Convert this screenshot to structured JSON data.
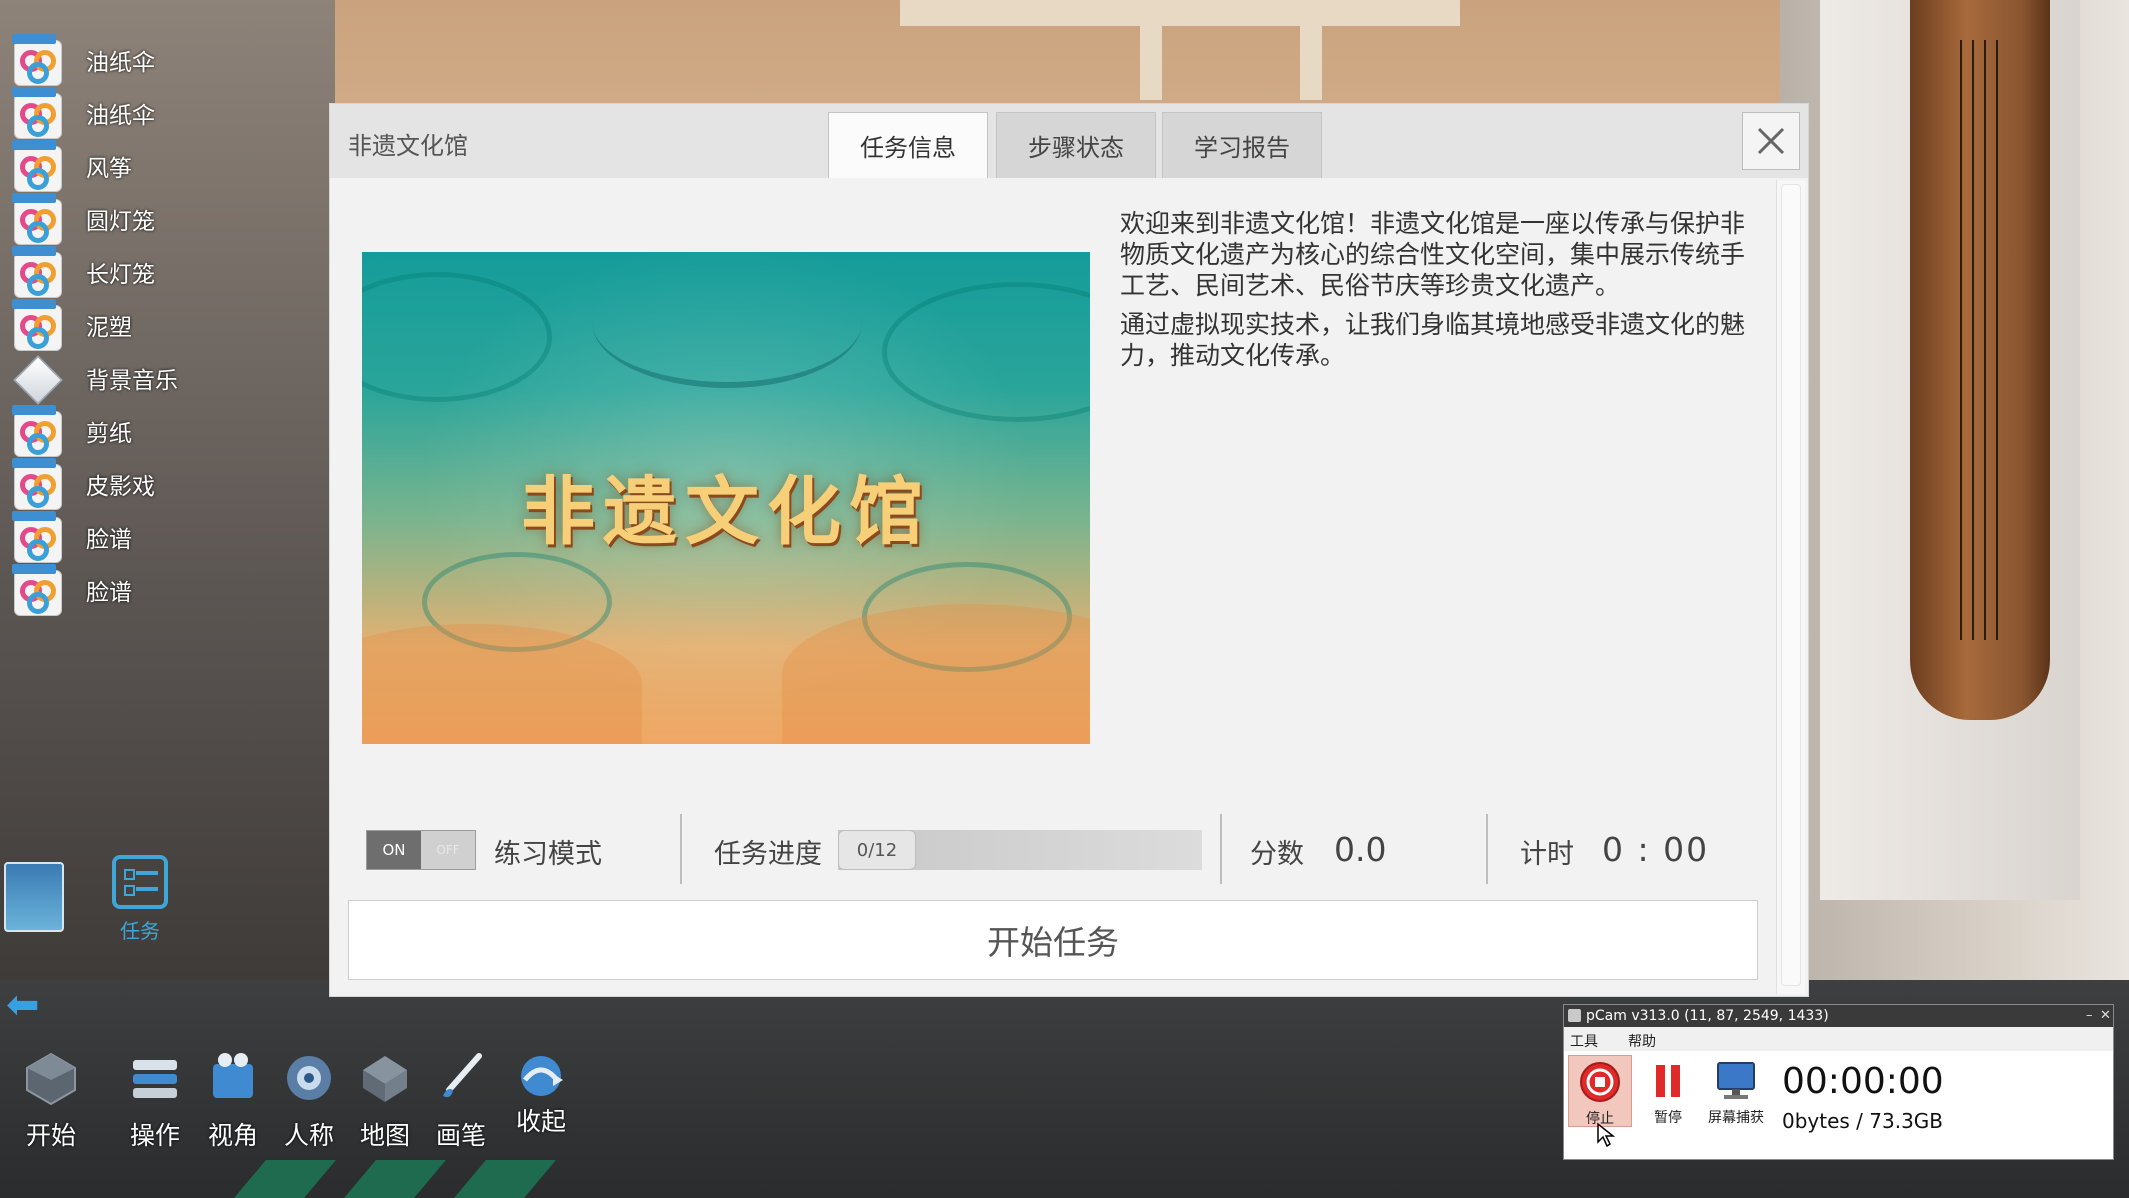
{
  "left_list": {
    "items": [
      {
        "label": "油纸伞"
      },
      {
        "label": "油纸伞"
      },
      {
        "label": "风筝"
      },
      {
        "label": "圆灯笼"
      },
      {
        "label": "长灯笼"
      },
      {
        "label": "泥塑"
      },
      {
        "label": "背景音乐"
      },
      {
        "label": "剪纸"
      },
      {
        "label": "皮影戏"
      },
      {
        "label": "脸谱"
      },
      {
        "label": "脸谱"
      }
    ],
    "task_label": "任务"
  },
  "toolbar": {
    "start": "开始",
    "operate": "操作",
    "view": "视角",
    "person": "人称",
    "map": "地图",
    "brush": "画笔",
    "collapse": "收起"
  },
  "dialog": {
    "title": "非遗文化馆",
    "tabs": [
      {
        "label": "任务信息",
        "active": true
      },
      {
        "label": "步骤状态",
        "active": false
      },
      {
        "label": "学习报告",
        "active": false
      }
    ],
    "banner_title": "非遗文化馆",
    "intro_p1": "欢迎来到非遗文化馆！非遗文化馆是一座以传承与保护非物质文化遗产为核心的综合性文化空间，集中展示传统手工艺、民间艺术、民俗节庆等珍贵文化遗产。",
    "intro_p2": "通过虚拟现实技术，让我们身临其境地感受非遗文化的魅力，推动文化传承。",
    "toggle_on": "ON",
    "toggle_off": "OFF",
    "mode_label": "练习模式",
    "progress_label": "任务进度",
    "progress_count": "0/12",
    "progress_done": 0,
    "progress_total": 12,
    "score_label": "分数",
    "score_value": "0.0",
    "time_label": "计时",
    "time_value": "0 : 00",
    "start_button": "开始任务"
  },
  "recorder": {
    "title": "pCam v313.0 (11, 87, 2549, 1433)",
    "menu_tools": "工具",
    "menu_help": "帮助",
    "stop": "停止",
    "pause": "暂停",
    "capture": "屏幕捕获",
    "elapsed": "00:00:00",
    "size": "0bytes / 73.3GB"
  },
  "colors": {
    "accent_blue": "#3fa7d8",
    "banner_teal": "#159c9a",
    "banner_orange": "#f0a765",
    "stop_red": "#e02a2a"
  }
}
